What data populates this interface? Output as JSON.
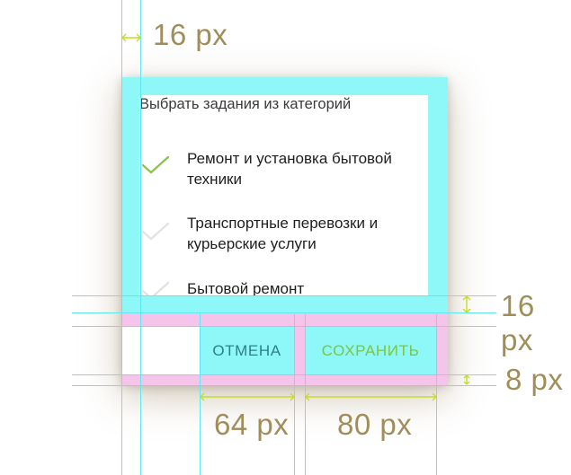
{
  "dialog": {
    "title": "Выбрать задания из категорий",
    "options": [
      {
        "label": "Ремонт и установка бытовой техники",
        "checked": true
      },
      {
        "label": "Транспортные перевозки и курьерские услуги",
        "checked": false
      },
      {
        "label": "Бытовой ремонт",
        "checked": false
      }
    ],
    "buttons": {
      "cancel_label": "ОТМЕНА",
      "save_label": "СОХРАНИТЬ"
    }
  },
  "annotations": {
    "left_padding": "16 px",
    "content_gap": "16 px",
    "bottom_padding": "8 px",
    "cancel_width": "64 px",
    "save_width": "80 px"
  },
  "colors": {
    "accent": "#8bc34a",
    "unchecked": "#e2e2e2",
    "button_text": "#2f7f86",
    "button_save": "#7bc641",
    "guide_cyan": "#8ef7f7",
    "guide_pink": "#f4c4ea",
    "dimension_text": "#a08e5a"
  },
  "icons": [
    "check-icon",
    "dimension-arrow-icon"
  ]
}
